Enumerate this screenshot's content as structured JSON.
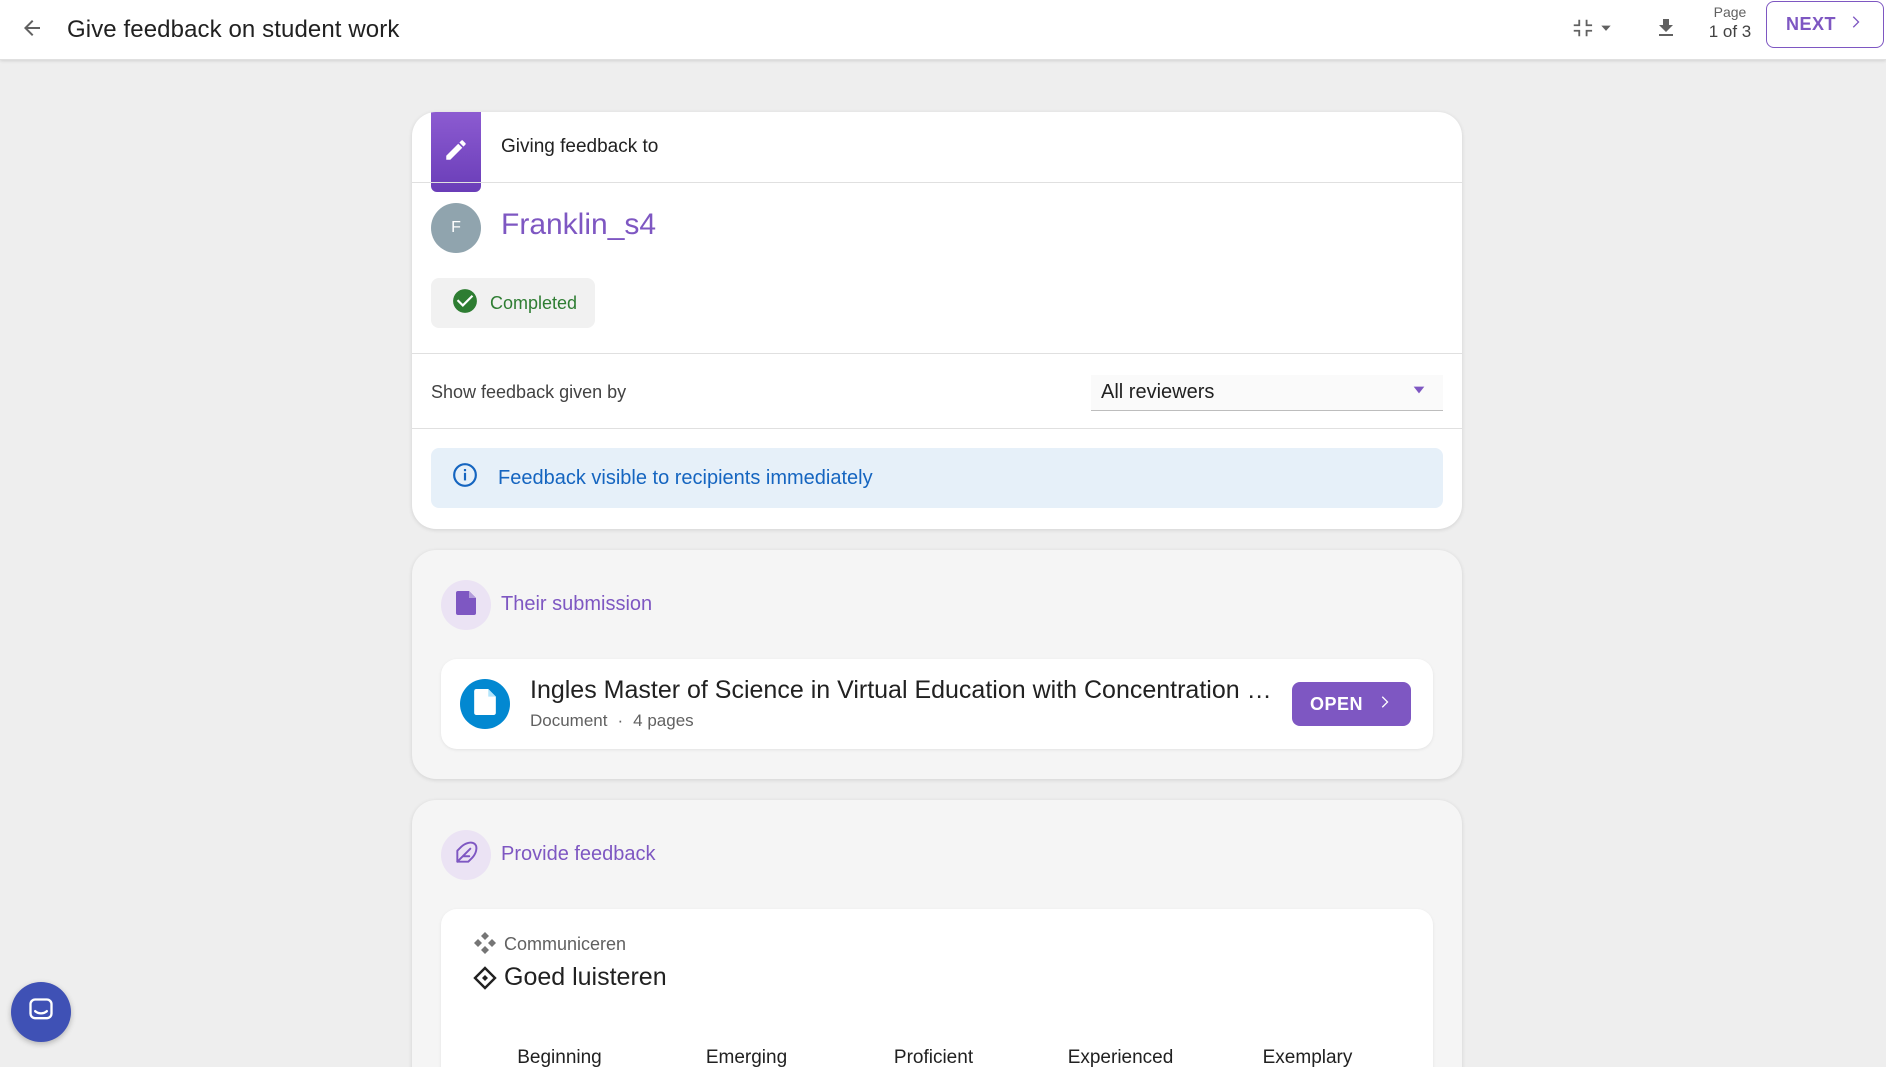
{
  "header": {
    "title": "Give feedback on student work",
    "page_label": "Page",
    "page_value": "1 of 3",
    "next_label": "NEXT"
  },
  "feedback_target": {
    "heading": "Giving feedback to",
    "avatar_initial": "F",
    "student_name": "Franklin_s4",
    "status": "Completed",
    "show_by_label": "Show feedback given by",
    "reviewer_filter": "All reviewers",
    "info_banner": "Feedback visible to recipients immediately"
  },
  "submission": {
    "section_title": "Their submission",
    "document_title": "Ingles Master of Science in Virtual Education with Concentration in Educational Technology",
    "document_type": "Document",
    "separator": "·",
    "document_pages": "4 pages",
    "open_label": "OPEN"
  },
  "provide_feedback": {
    "section_title": "Provide feedback",
    "category": "Communiceren",
    "criterion": "Goed luisteren",
    "levels": [
      "Beginning",
      "Emerging",
      "Proficient",
      "Experienced",
      "Exemplary"
    ]
  },
  "colors": {
    "accent": "#7e57c2",
    "info_text": "#1565c0",
    "info_bg": "#e6f0f9",
    "success": "#2e7d32",
    "doc_icon_bg": "#0288d1",
    "chat_fab": "#3f51b5"
  },
  "icons": {
    "back": "arrow-left-icon",
    "compress": "compress-icon",
    "download": "download-icon",
    "next": "chevron-right-icon",
    "edit": "pencil-icon",
    "status": "check-circle-icon",
    "dropdown": "caret-down-icon",
    "info": "info-icon",
    "submission": "file-icon",
    "document": "document-icon",
    "feedback": "feather-icon",
    "category": "diamonds-icon",
    "criterion": "diamond-icon",
    "chat": "chat-icon"
  }
}
